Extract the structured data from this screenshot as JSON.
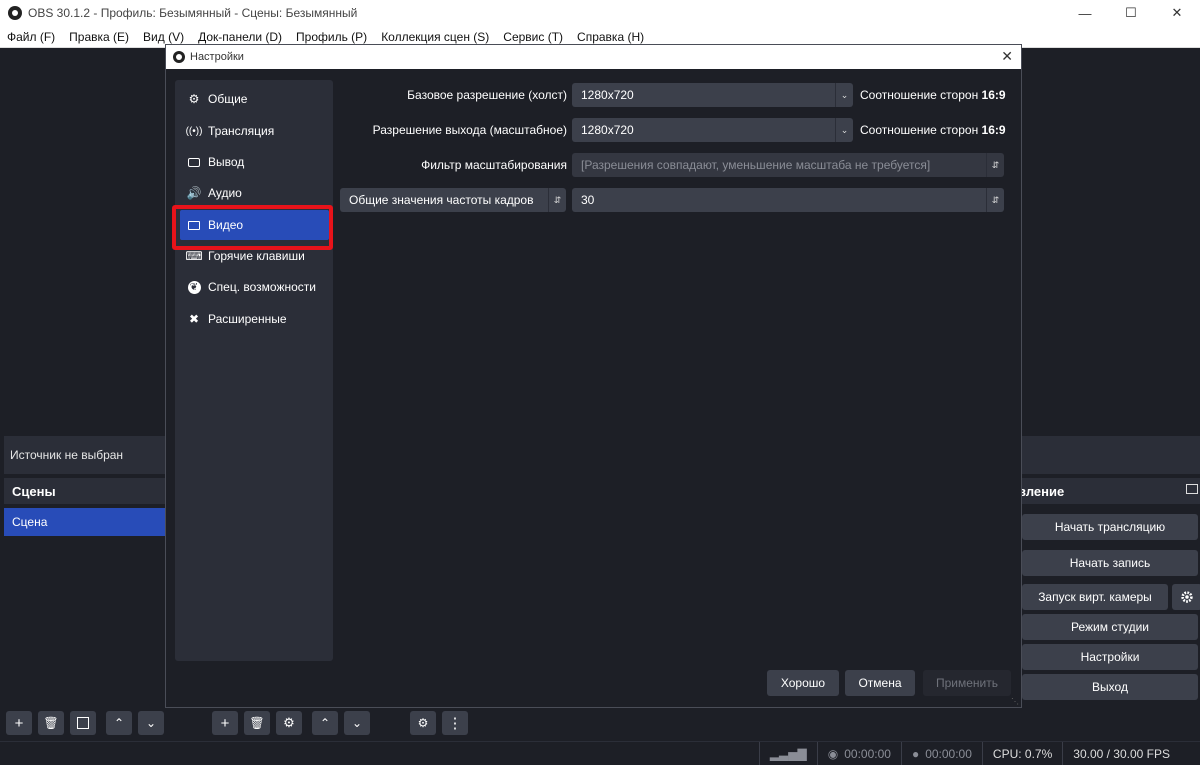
{
  "window": {
    "title": "OBS 30.1.2 - Профиль: Безымянный - Сцены: Безымянный"
  },
  "menu": [
    "Файл (F)",
    "Правка (E)",
    "Вид (V)",
    "Док-панели (D)",
    "Профиль (P)",
    "Коллекция сцен (S)",
    "Сервис (T)",
    "Справка (H)"
  ],
  "source_bar": {
    "text": "Источник не выбран"
  },
  "scenes": {
    "header": "Сцены",
    "items": [
      "Сцена"
    ]
  },
  "controls": {
    "header": "вление",
    "buttons": [
      "Начать трансляцию",
      "Начать запись",
      "Запуск вирт. камеры",
      "Режим студии",
      "Настройки",
      "Выход"
    ]
  },
  "statusbar": {
    "stream_time": "00:00:00",
    "record_time": "00:00:00",
    "cpu": "CPU: 0.7%",
    "fps": "30.00 / 30.00 FPS"
  },
  "settings": {
    "title": "Настройки",
    "sidebar": [
      {
        "label": "Общие",
        "icon": "gear-icon"
      },
      {
        "label": "Трансляция",
        "icon": "broadcast-icon"
      },
      {
        "label": "Вывод",
        "icon": "output-icon"
      },
      {
        "label": "Аудио",
        "icon": "speaker-icon"
      },
      {
        "label": "Видео",
        "icon": "monitor-icon"
      },
      {
        "label": "Горячие клавиши",
        "icon": "keyboard-icon"
      },
      {
        "label": "Спец. возможности",
        "icon": "accessibility-icon"
      },
      {
        "label": "Расширенные",
        "icon": "tools-icon"
      }
    ],
    "active_item": "Видео",
    "video": {
      "base_resolution": {
        "label": "Базовое разрешение (холст)",
        "value": "1280x720",
        "aspect_label": "Соотношение сторон",
        "aspect_value": "16:9"
      },
      "output_resolution": {
        "label": "Разрешение выхода (масштабное)",
        "value": "1280x720",
        "aspect_label": "Соотношение сторон",
        "aspect_value": "16:9"
      },
      "scale_filter": {
        "label": "Фильтр масштабирования",
        "value": "[Разрешения совпадают, уменьшение масштаба не требуется]"
      },
      "fps_type": {
        "value": "Общие значения частоты кадров"
      },
      "fps_value": {
        "value": "30"
      }
    },
    "buttons": {
      "ok": "Хорошо",
      "cancel": "Отмена",
      "apply": "Применить"
    }
  },
  "colors": {
    "accent": "#284cb8",
    "highlight": "#e8131a",
    "panel": "#2b2e38",
    "background": "#1d1f26"
  }
}
